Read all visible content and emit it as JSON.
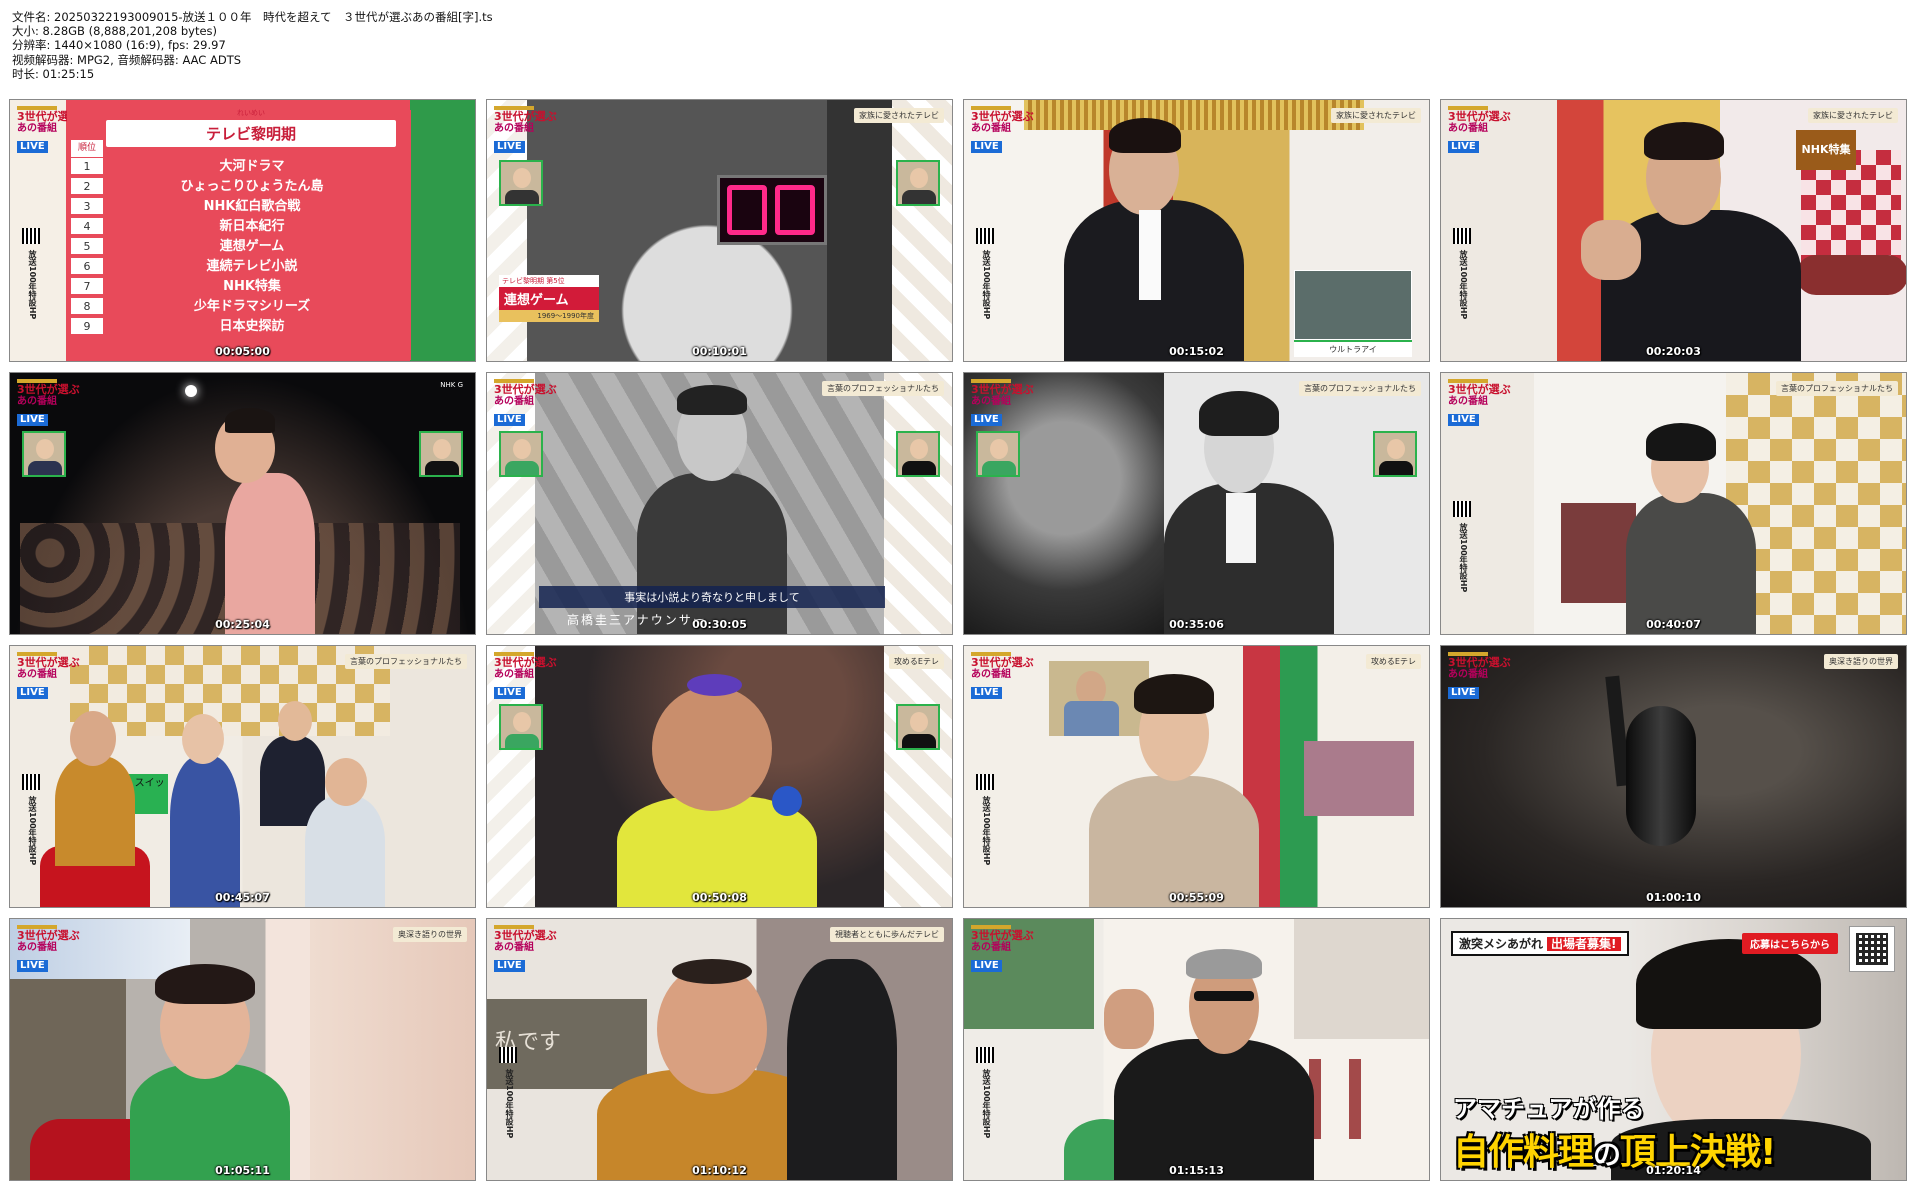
{
  "header": {
    "filename": "文件名: 20250322193009015-放送１００年　時代を超えて　３世代が選ぶあの番組[字].ts",
    "size": "大小: 8.28GB (8,888,201,208 bytes)",
    "resolution": "分辨率: 1440×1080 (16:9), fps: 29.97",
    "codec": "视频解码器: MPG2, 音频解码器: AAC ADTS",
    "duration": "时长: 01:25:15"
  },
  "common": {
    "logo_line1": "3世代が選ぶ",
    "logo_line2": "あの番組",
    "logo_live": "LIVE",
    "side_text": "放送100年特設HP"
  },
  "tiles": [
    {
      "time": "00:05:00",
      "tag": ""
    },
    {
      "time": "00:10:01",
      "tag": "家族に愛されたテレビ"
    },
    {
      "time": "00:15:02",
      "tag": "家族に愛されたテレビ"
    },
    {
      "time": "00:20:03",
      "tag": "家族に愛されたテレビ"
    },
    {
      "time": "00:25:04",
      "tag": "NHK G"
    },
    {
      "time": "00:30:05",
      "tag": "言葉のプロフェッショナルたち"
    },
    {
      "time": "00:35:06",
      "tag": "言葉のプロフェッショナルたち"
    },
    {
      "time": "00:40:07",
      "tag": "言葉のプロフェッショナルたち"
    },
    {
      "time": "00:45:07",
      "tag": "言葉のプロフェッショナルたち"
    },
    {
      "time": "00:50:08",
      "tag": "攻めるEテレ"
    },
    {
      "time": "00:55:09",
      "tag": "攻めるEテレ"
    },
    {
      "time": "01:00:10",
      "tag": "奥深き語りの世界"
    },
    {
      "time": "01:05:11",
      "tag": "奥深き語りの世界"
    },
    {
      "time": "01:10:12",
      "tag": "視聴者とともに歩んだテレビ"
    },
    {
      "time": "01:15:13",
      "tag": ""
    },
    {
      "time": "01:20:14",
      "tag": ""
    }
  ],
  "ranking": {
    "title": "テレビ黎明期",
    "ruby": "れいめい",
    "col_head": "順位",
    "rows": [
      {
        "no": "1",
        "name": "大河ドラマ"
      },
      {
        "no": "2",
        "name": "ひょっこりひょうたん島"
      },
      {
        "no": "3",
        "name": "NHK紅白歌合戦"
      },
      {
        "no": "4",
        "name": "新日本紀行"
      },
      {
        "no": "5",
        "name": "連想ゲーム"
      },
      {
        "no": "6",
        "name": "連続テレビ小説"
      },
      {
        "no": "7",
        "name": "NHK特集"
      },
      {
        "no": "8",
        "name": "少年ドラマシリーズ"
      },
      {
        "no": "9",
        "name": "日本史探訪"
      }
    ]
  },
  "tile2": {
    "lt_small": "テレビ黎明期 第5位",
    "lt_title": "連想ゲーム",
    "lt_years": "1969～1990年度"
  },
  "tile3": {
    "caption": "ウルトラアイ"
  },
  "tile4": {
    "sign": "NHK特集"
  },
  "tile6": {
    "subtitle": "事実は小説より奇なりと申しまして",
    "bottom_text": "高橋圭三アナウンサー"
  },
  "tile9": {
    "board_text": "ピタゴ スイッ"
  },
  "tile14": {
    "board_text": "私です"
  },
  "tile16": {
    "badge": "激突メシあがれ",
    "badge_red": "出場者募集!",
    "apply": "応募はこちらから",
    "line1": "アマチュアが作る",
    "line2a": "自作料理",
    "line2b": "の",
    "line2c": "頂上決戦!"
  }
}
